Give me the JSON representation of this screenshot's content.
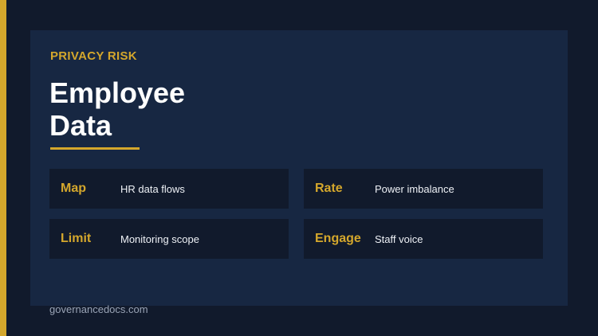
{
  "slide": {
    "eyebrow": "PRIVACY RISK",
    "title_line_1": "Employee",
    "title_line_2": "Data",
    "footer": "governancedocs.com"
  },
  "tiles": [
    {
      "key": "Map",
      "desc": "HR data flows"
    },
    {
      "key": "Rate",
      "desc": "Power imbalance"
    },
    {
      "key": "Limit",
      "desc": "Monitoring scope"
    },
    {
      "key": "Engage",
      "desc": "Staff voice"
    }
  ],
  "colors": {
    "background": "#111a2c",
    "card": "#172742",
    "accent": "#d4a72c",
    "title": "#ffffff",
    "muted": "#9aa4b6"
  }
}
